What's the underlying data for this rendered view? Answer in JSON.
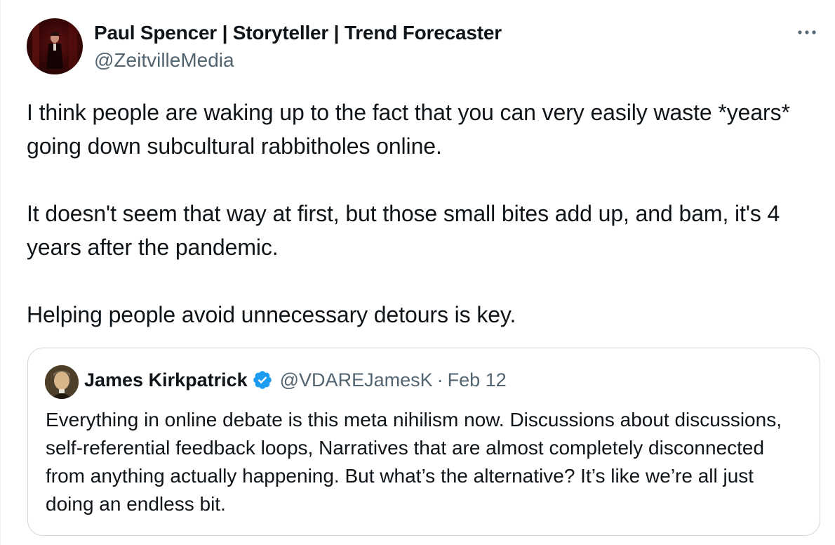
{
  "tweet": {
    "author_name": "Paul Spencer | Storyteller | Trend Forecaster",
    "author_handle": "@ZeitvilleMedia",
    "more_icon": "more-dots-icon",
    "paragraphs": [
      "I think people are waking up to the fact that you can very easily waste *years* going down subcultural rabbitholes online.",
      "It doesn't seem that way at first, but those small bites add up, and bam, it's 4 years after the pandemic.",
      "Helping people avoid unnecessary detours is key."
    ]
  },
  "quote": {
    "author_name": "James Kirkpatrick",
    "verified_icon": "verified-badge-icon",
    "author_handle": "@VDAREJamesK",
    "separator": "·",
    "date": "Feb 12",
    "text": "Everything in online debate is this meta nihilism now. Discussions about discussions, self-referential feedback loops, Narratives that are almost completely disconnected from anything actually happening. But what’s the alternative? It’s like we’re all just doing an endless bit."
  },
  "colors": {
    "text_primary": "#0f1419",
    "text_secondary": "#536471",
    "verified_blue": "#1d9bf0",
    "border": "#cfd9de"
  }
}
